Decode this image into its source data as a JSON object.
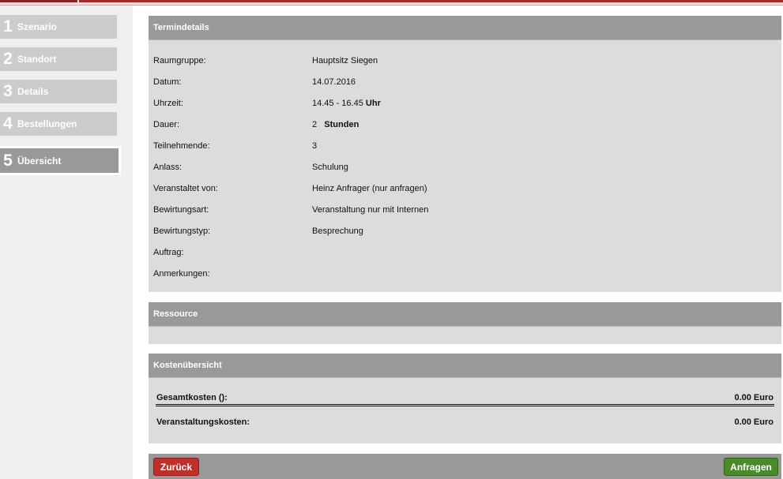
{
  "steps": [
    {
      "num": "1",
      "label": "Szenario"
    },
    {
      "num": "2",
      "label": "Standort"
    },
    {
      "num": "3",
      "label": "Details"
    },
    {
      "num": "4",
      "label": "Bestellungen"
    },
    {
      "num": "5",
      "label": "Übersicht"
    }
  ],
  "termindetails": {
    "title": "Termindetails",
    "fields": [
      {
        "label": "Raumgruppe:",
        "value": "Hauptsitz Siegen"
      },
      {
        "label": "Datum:",
        "value": "14.07.2016"
      },
      {
        "label": "Uhrzeit:",
        "value": "14.45 - 16.45",
        "suffix": "Uhr"
      },
      {
        "label": "Dauer:",
        "value": "2",
        "suffix": "Stunden"
      },
      {
        "label": "Teilnehmende:",
        "value": "3"
      },
      {
        "label": "Anlass:",
        "value": "Schulung"
      },
      {
        "label": "Veranstaltet von:",
        "value": "Heinz Anfrager (nur anfragen)"
      },
      {
        "label": "Bewirtungsart:",
        "value": "Veranstaltung nur mit Internen"
      },
      {
        "label": "Bewirtungstyp:",
        "value": "Besprechung"
      },
      {
        "label": "Auftrag:",
        "value": ""
      },
      {
        "label": "Anmerkungen:",
        "value": ""
      }
    ]
  },
  "ressource": {
    "title": "Ressource"
  },
  "kosten": {
    "title": "Kostenübersicht",
    "gesamt_label": "Gesamtkosten ():",
    "gesamt_value": "0.00 Euro",
    "veranstaltung_label": "Veranstaltungskosten:",
    "veranstaltung_value": "0.00 Euro"
  },
  "buttons": {
    "back": "Zurück",
    "submit": "Anfragen"
  },
  "colors": {
    "accent_red": "#c0302a",
    "accent_green": "#4a8a2a",
    "header_gray": "#999999"
  }
}
